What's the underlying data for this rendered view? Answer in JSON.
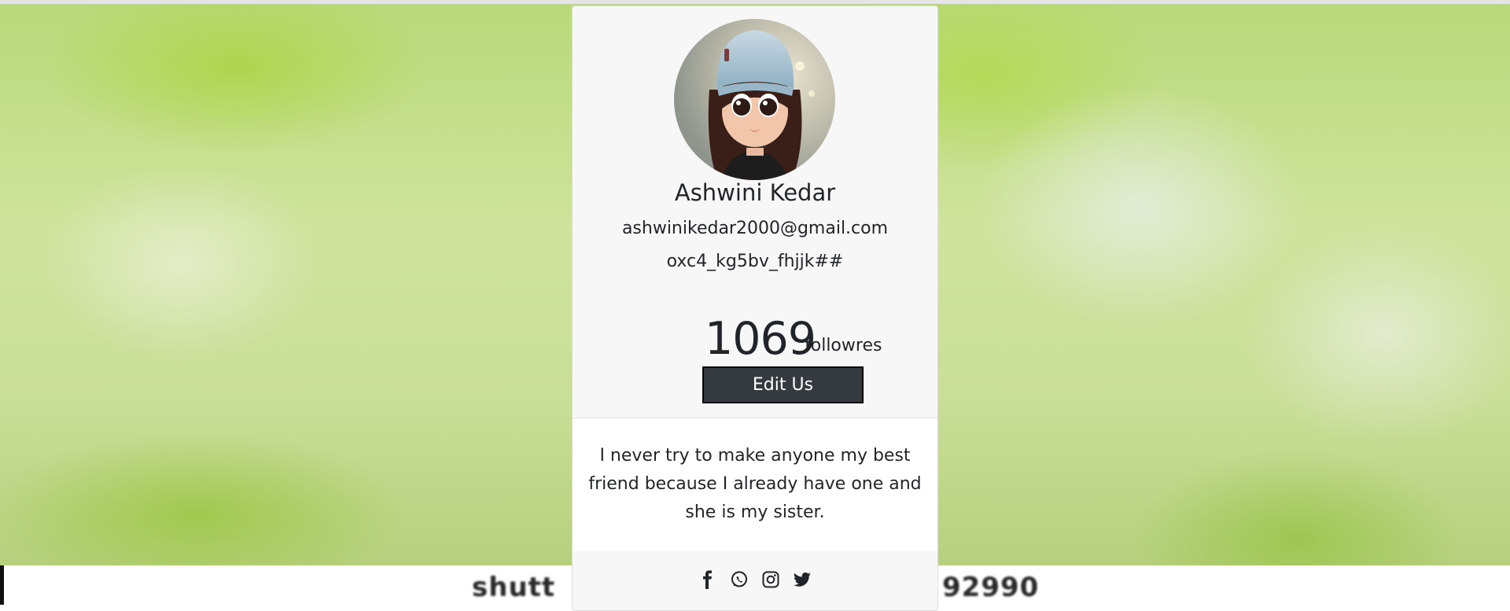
{
  "profile": {
    "name": "Ashwini Kedar",
    "email": "ashwinikedar2000@gmail.com",
    "handle": "oxc4_kg5bv_fhjjk##",
    "followers_count": "1069",
    "followers_label": "followres",
    "edit_button_label": "Edit Us",
    "bio": "I never try to make anyone my best friend because I already have one and she is my sister."
  },
  "social_icons": [
    "facebook-icon",
    "whatsapp-icon",
    "instagram-icon",
    "twitter-icon"
  ],
  "background": {
    "watermark_left": "shutt",
    "watermark_right": "92990"
  },
  "colors": {
    "button_bg": "#343a40",
    "card_bg": "#f7f7f7",
    "text": "#212529"
  }
}
